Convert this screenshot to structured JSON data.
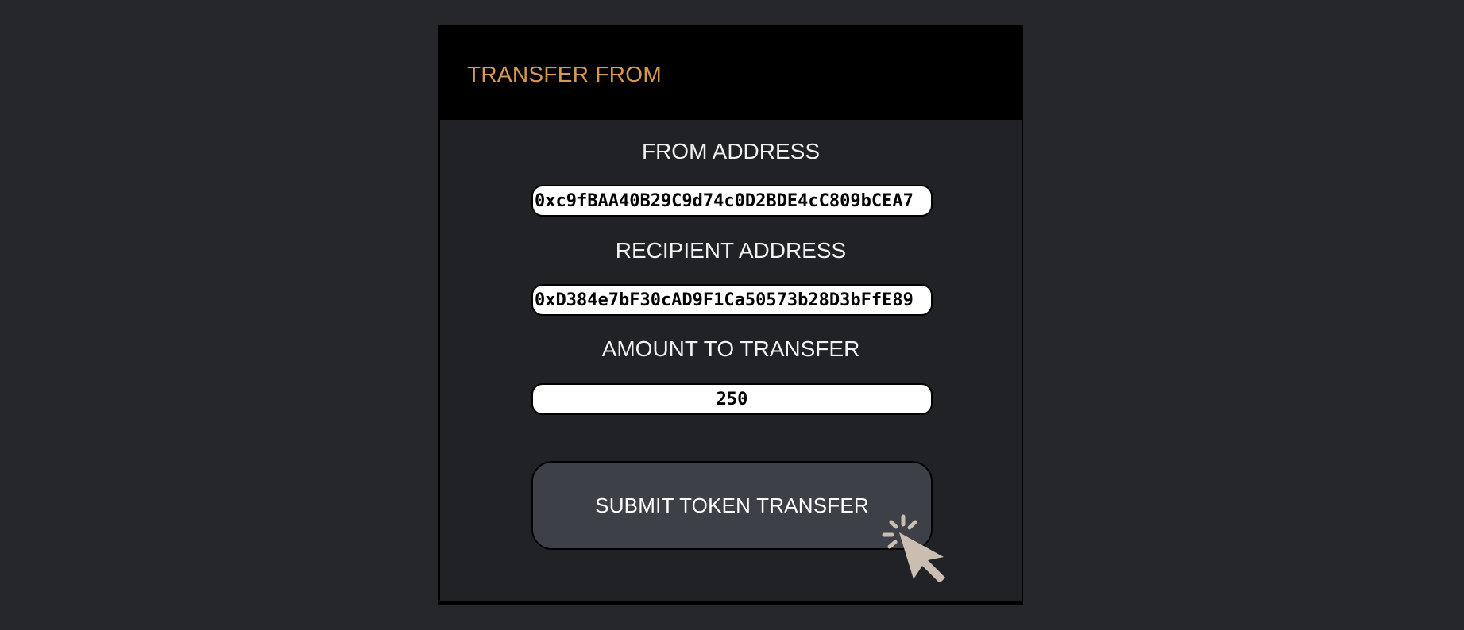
{
  "header": {
    "title": "TRANSFER FROM"
  },
  "form": {
    "from_label": "FROM ADDRESS",
    "from_value": "0xc9fBAA40B29C9d74c0D2BDE4cC809bCEA7",
    "recipient_label": "RECIPIENT ADDRESS",
    "recipient_value": "0xD384e7bF30cAD9F1Ca50573b28D3bFfE89",
    "amount_label": "AMOUNT TO TRANSFER",
    "amount_value": "250",
    "submit_label": "SUBMIT TOKEN TRANSFER"
  },
  "cursor": {
    "icon": "click-pointer-icon"
  },
  "colors": {
    "page_bg": "#25272b",
    "card_bg": "#202226",
    "header_bg": "#000000",
    "title": "#d69a4f",
    "button_bg": "#3d4047",
    "cursor": "#c9beb1"
  }
}
